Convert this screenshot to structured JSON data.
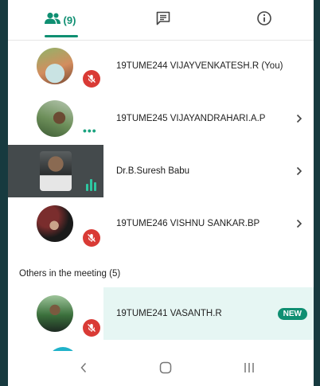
{
  "tabs": {
    "people_icon": "people-icon",
    "people_count": "(9)",
    "chat_icon": "chat-icon",
    "info_icon": "info-icon"
  },
  "participants": [
    {
      "name": "19TUME244 VIJAYVENKATESH.R (You)",
      "status": "muted"
    },
    {
      "name": "19TUME245 VIJAYANDRAHARI.A.P",
      "status": "more"
    },
    {
      "name": "Dr.B.Suresh Babu",
      "status": "speaking"
    },
    {
      "name": "19TUME246 VISHNU SANKAR.BP",
      "status": "muted"
    }
  ],
  "others": {
    "title": "Others in the meeting (5)",
    "items": [
      {
        "name": "19TUME241 VASANTH.R",
        "status": "muted",
        "badge": "NEW"
      }
    ]
  },
  "colors": {
    "accent": "#0f8f72",
    "muted_badge": "#d93a35",
    "speaking": "#2ec7a1",
    "highlight": "#e6f6f3"
  },
  "navbar": {
    "back_icon": "back-icon",
    "home_icon": "home-icon",
    "recents_icon": "recents-icon"
  }
}
